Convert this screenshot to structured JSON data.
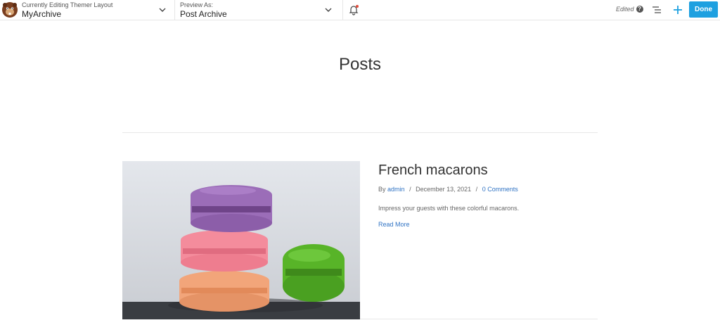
{
  "toolbar": {
    "editing_label": "Currently Editing Themer Layout",
    "layout_name": "MyArchive",
    "preview_label": "Preview As:",
    "preview_value": "Post Archive",
    "status": "Edited",
    "help_glyph": "?",
    "done_label": "Done",
    "accent_color": "#1ea0e0"
  },
  "page": {
    "title": "Posts"
  },
  "post": {
    "title": "French macarons",
    "by_label": "By",
    "author": "admin",
    "date": "December 13, 2021",
    "comments": "0 Comments",
    "excerpt": "Impress your guests with these colorful macarons.",
    "read_more": "Read More",
    "link_color": "#3174c4"
  },
  "icons": {
    "logo": "beaver-logo-icon",
    "chevron": "chevron-down-icon",
    "notifications": "bell-icon",
    "outline": "outline-list-icon",
    "add": "plus-icon",
    "help": "help-icon"
  }
}
